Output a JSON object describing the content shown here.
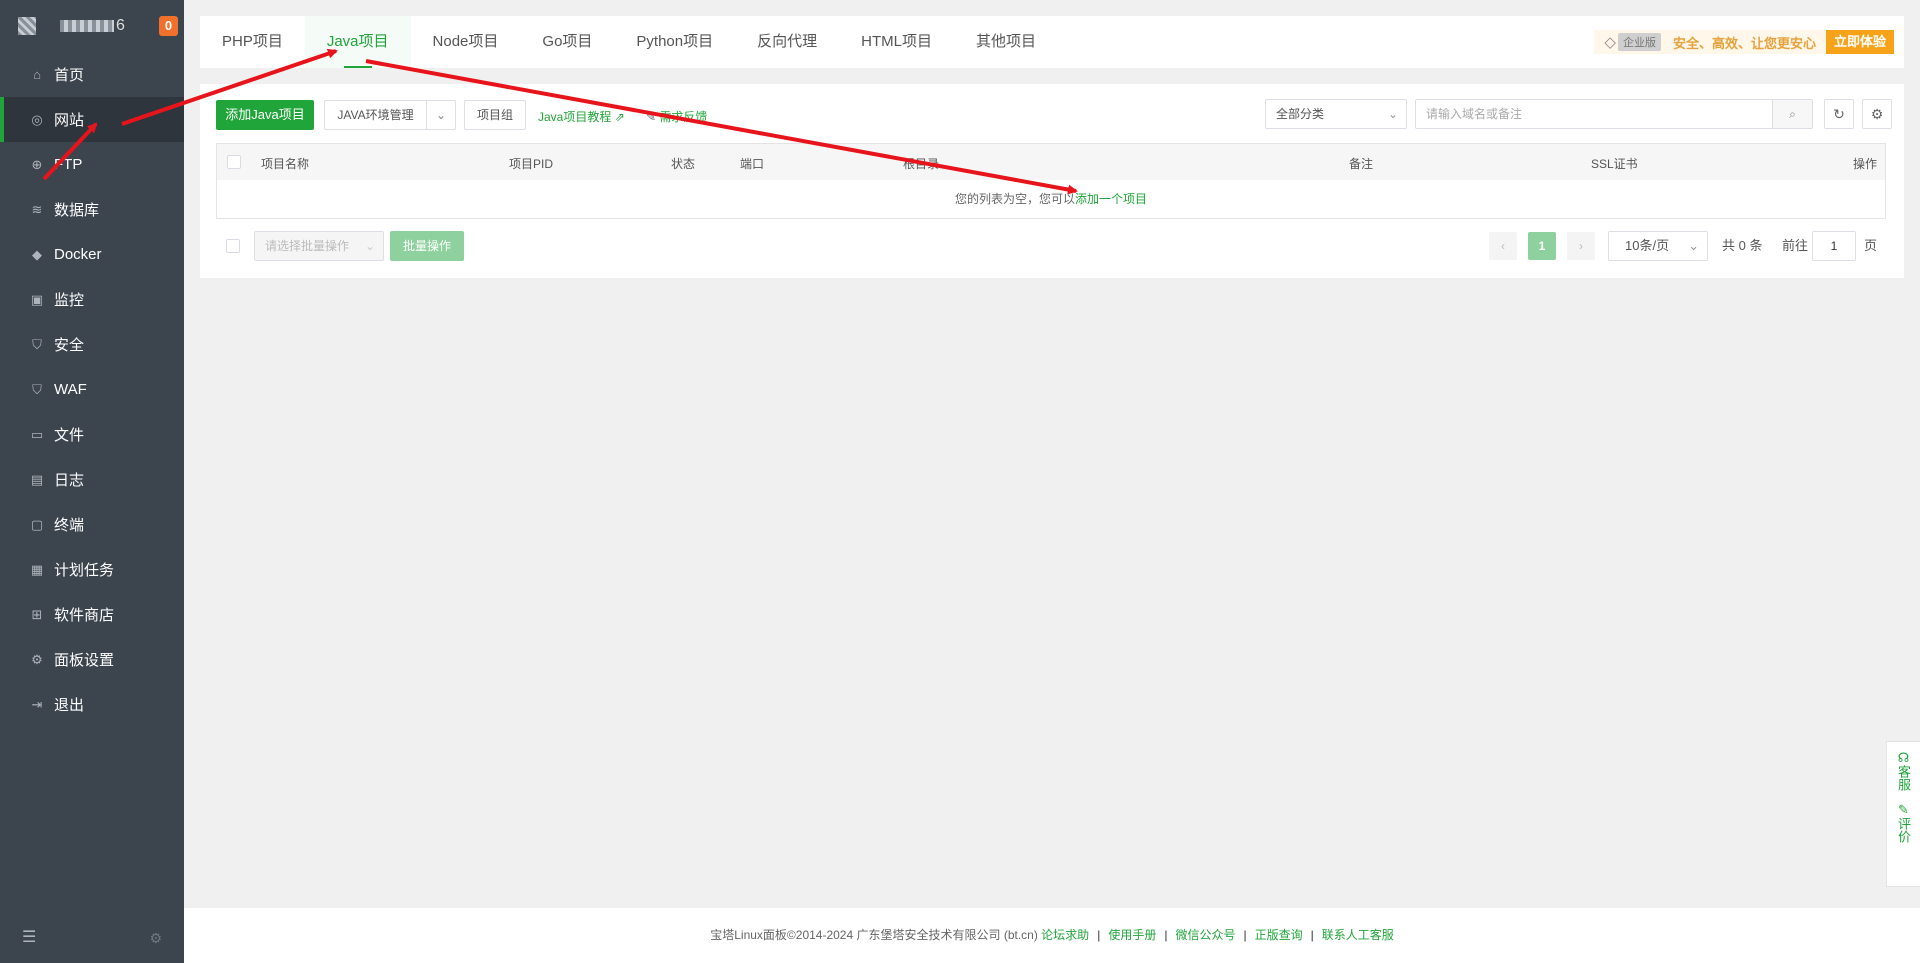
{
  "brand": {
    "name_suffix": "6",
    "badge": "0"
  },
  "sidebar": {
    "items": [
      {
        "label": "首页",
        "icon": "home-icon",
        "glyph": "⌂"
      },
      {
        "label": "网站",
        "icon": "globe-icon",
        "glyph": "◎",
        "active": true
      },
      {
        "label": "FTP",
        "icon": "ftp-icon",
        "glyph": "⊕"
      },
      {
        "label": "数据库",
        "icon": "database-icon",
        "glyph": "≋"
      },
      {
        "label": "Docker",
        "icon": "docker-icon",
        "glyph": "◆"
      },
      {
        "label": "监控",
        "icon": "monitor-icon",
        "glyph": "▣"
      },
      {
        "label": "安全",
        "icon": "shield-icon",
        "glyph": "⛉"
      },
      {
        "label": "WAF",
        "icon": "waf-shield-icon",
        "glyph": "⛉"
      },
      {
        "label": "文件",
        "icon": "folder-icon",
        "glyph": "▭"
      },
      {
        "label": "日志",
        "icon": "log-icon",
        "glyph": "▤"
      },
      {
        "label": "终端",
        "icon": "terminal-icon",
        "glyph": "▢"
      },
      {
        "label": "计划任务",
        "icon": "calendar-icon",
        "glyph": "▦"
      },
      {
        "label": "软件商店",
        "icon": "apps-icon",
        "glyph": "⊞"
      },
      {
        "label": "面板设置",
        "icon": "settings-icon",
        "glyph": "⚙"
      },
      {
        "label": "退出",
        "icon": "logout-icon",
        "glyph": "⇥"
      }
    ]
  },
  "tabs": [
    {
      "label": "PHP项目"
    },
    {
      "label": "Java项目",
      "active": true
    },
    {
      "label": "Node项目"
    },
    {
      "label": "Go项目"
    },
    {
      "label": "Python项目"
    },
    {
      "label": "反向代理"
    },
    {
      "label": "HTML项目"
    },
    {
      "label": "其他项目"
    }
  ],
  "promo": {
    "badge": "企业版",
    "slogan": "安全、高效、让您更安心",
    "button": "立即体验"
  },
  "toolbar": {
    "add_button": "添加Java项目",
    "env_button": "JAVA环境管理",
    "group_button": "项目组",
    "tutorial_link": "Java项目教程",
    "feedback_link": "需求反馈",
    "category_select": "全部分类",
    "search_placeholder": "请输入域名或备注"
  },
  "table": {
    "columns": [
      "项目名称",
      "项目PID",
      "状态",
      "端口",
      "根目录",
      "备注",
      "SSL证书",
      "操作"
    ],
    "empty_text": "您的列表为空，您可以",
    "empty_link": "添加一个项目"
  },
  "batch": {
    "select_placeholder": "请选择批量操作",
    "button": "批量操作"
  },
  "pagination": {
    "current_page": "1",
    "page_size": "10条/页",
    "total": "共 0 条",
    "goto_label": "前往",
    "goto_value": "1",
    "page_suffix": "页"
  },
  "footer": {
    "copyright": "宝塔Linux面板©2014-2024 广东堡塔安全技术有限公司 (bt.cn)",
    "links": [
      "论坛求助",
      "使用手册",
      "微信公众号",
      "正版查询",
      "联系人工客服"
    ]
  },
  "float_side": {
    "service": "客服",
    "review": "评价"
  },
  "colors": {
    "accent": "#20a53a",
    "sidebar_bg": "#3c444d",
    "annotation_arrow": "#e8141c",
    "promo_gold": "#f6a31a"
  }
}
